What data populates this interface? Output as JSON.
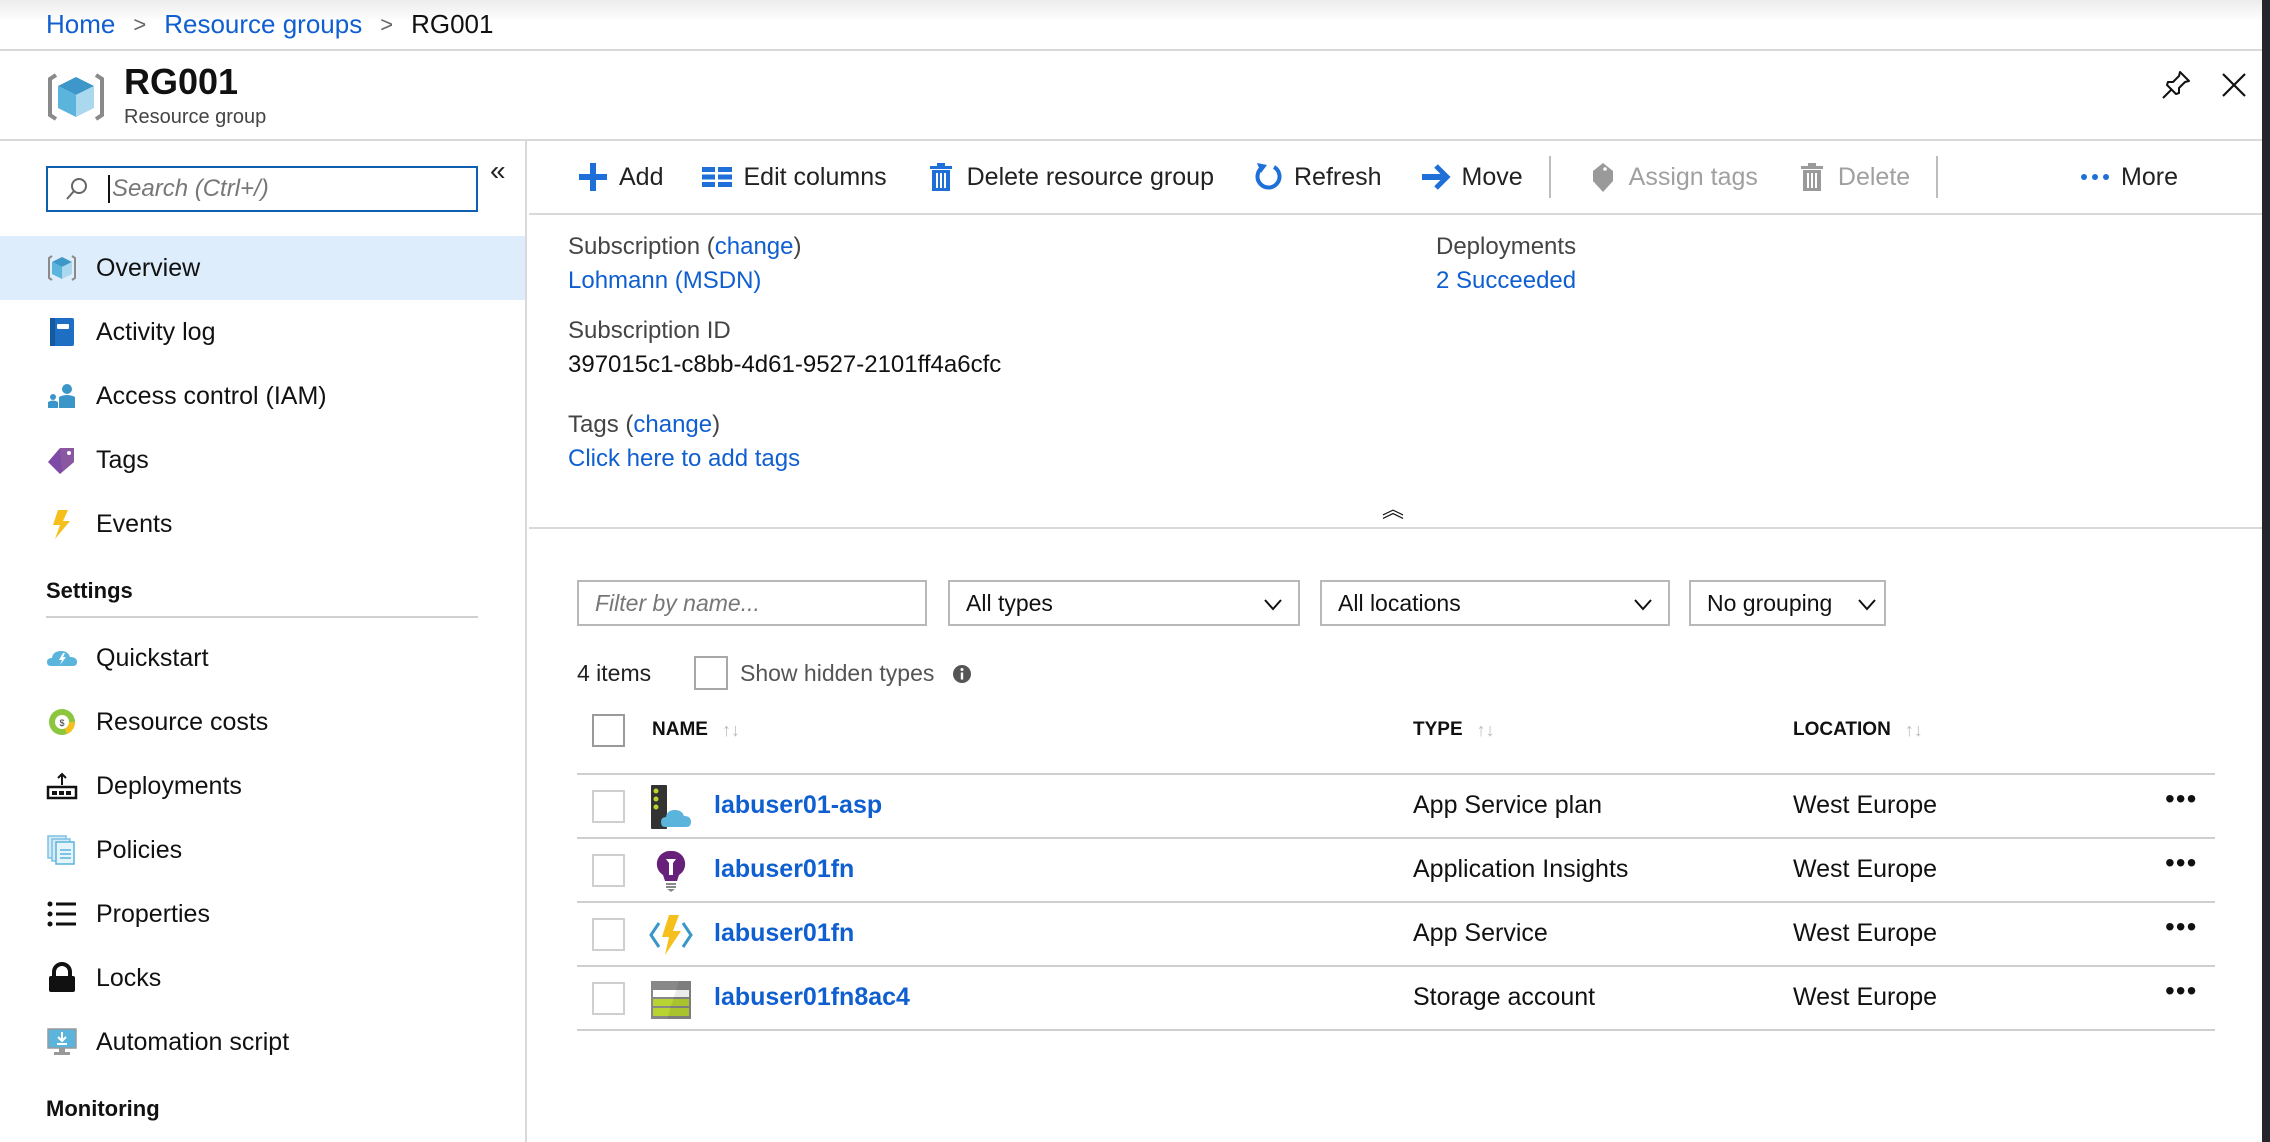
{
  "breadcrumb": {
    "items": [
      "Home",
      "Resource groups"
    ],
    "separator": ">",
    "current": "RG001"
  },
  "blade": {
    "title": "RG001",
    "subtitle": "Resource group",
    "icons": {
      "pin": "pin-icon",
      "close": "close-icon"
    }
  },
  "sidebar": {
    "search_placeholder": "Search (Ctrl+/)",
    "collapse_glyph": "«",
    "items": [
      {
        "label": "Overview",
        "icon": "resource-group-icon",
        "active": true
      },
      {
        "label": "Activity log",
        "icon": "activity-log-icon"
      },
      {
        "label": "Access control (IAM)",
        "icon": "iam-icon"
      },
      {
        "label": "Tags",
        "icon": "tag-icon"
      },
      {
        "label": "Events",
        "icon": "lightning-icon"
      }
    ],
    "sections": [
      {
        "header": "Settings",
        "items": [
          {
            "label": "Quickstart",
            "icon": "quickstart-cloud-icon"
          },
          {
            "label": "Resource costs",
            "icon": "cost-icon"
          },
          {
            "label": "Deployments",
            "icon": "deployments-icon"
          },
          {
            "label": "Policies",
            "icon": "policies-icon"
          },
          {
            "label": "Properties",
            "icon": "properties-list-icon"
          },
          {
            "label": "Locks",
            "icon": "lock-icon"
          },
          {
            "label": "Automation script",
            "icon": "automation-script-icon"
          }
        ]
      },
      {
        "header": "Monitoring",
        "items": []
      }
    ]
  },
  "toolbar": {
    "add": "Add",
    "edit_columns": "Edit columns",
    "delete_resource_group": "Delete resource group",
    "refresh": "Refresh",
    "move": "Move",
    "assign_tags": "Assign tags",
    "delete": "Delete",
    "more": "More"
  },
  "essentials": {
    "subscription_label": "Subscription",
    "change_link": "change",
    "subscription_name": "Lohmann (MSDN)",
    "subscription_id_label": "Subscription ID",
    "subscription_id": "397015c1-c8bb-4d61-9527-2101ff4a6cfc",
    "tags_label": "Tags",
    "tags_add_link": "Click here to add tags",
    "deployments_label": "Deployments",
    "deployments_value": "2 Succeeded",
    "collapse_glyph": "︽"
  },
  "filters": {
    "name_placeholder": "Filter by name...",
    "types_selected": "All types",
    "locations_selected": "All locations",
    "grouping_selected": "No grouping"
  },
  "list": {
    "count_text": "4 items",
    "show_hidden_label": "Show hidden types",
    "show_hidden_checked": false,
    "columns": [
      "NAME",
      "TYPE",
      "LOCATION"
    ],
    "sort_glyph": "↑↓",
    "more_glyph": "•••",
    "rows": [
      {
        "name": "labuser01-asp",
        "type": "App Service plan",
        "location": "West Europe",
        "icon": "app-service-plan-icon"
      },
      {
        "name": "labuser01fn",
        "type": "Application Insights",
        "location": "West Europe",
        "icon": "application-insights-icon"
      },
      {
        "name": "labuser01fn",
        "type": "App Service",
        "location": "West Europe",
        "icon": "function-app-icon"
      },
      {
        "name": "labuser01fn8ac4",
        "type": "Storage account",
        "location": "West Europe",
        "icon": "storage-account-icon"
      }
    ]
  },
  "colors": {
    "link": "#0f5fd1",
    "active_nav_bg": "#ddedfb",
    "search_border": "#0f5fb0",
    "divider": "#d9d9d9"
  }
}
